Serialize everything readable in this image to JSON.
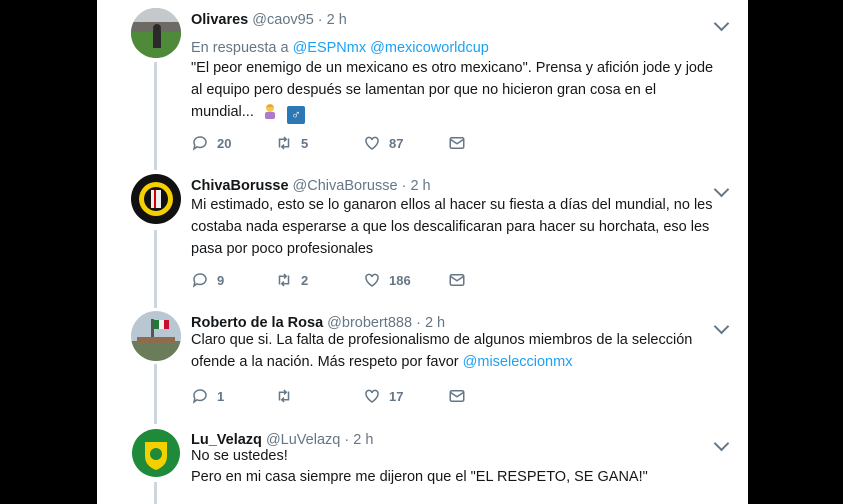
{
  "tweets": [
    {
      "name": "Olivares",
      "handle": "@caov95",
      "time": "2 h",
      "reply_prefix": "En respuesta a",
      "reply_mention1": "@ESPNmx",
      "reply_mention2": "@mexicoworldcup",
      "line1": "\"El peor enemigo de un mexicano es otro mexicano\". Prensa y afición jode y jode",
      "line2": "al equipo pero después se lamentan por que no hicieron gran cosa en el",
      "line3": "mundial...",
      "male_sign": "♂",
      "replies": "20",
      "retweets": "5",
      "likes": "87"
    },
    {
      "name": "ChivaBorusse",
      "handle": "@ChivaBorusse",
      "time": "2 h",
      "line1": "Mi estimado, esto se lo ganaron ellos al hacer su fiesta a días del mundial, no les",
      "line2": "costaba nada esperarse a que los descalificaran para hacer su horchata, eso les",
      "line3": "pasa por poco profesionales",
      "replies": "9",
      "retweets": "2",
      "likes": "186"
    },
    {
      "name": "Roberto de la Rosa",
      "handle": "@brobert888",
      "time": "2 h",
      "line1": "Claro que si. La falta de profesionalismo de algunos miembros de la selección",
      "line2_prefix": "ofende a  la nación. Más respeto por favor",
      "line2_mention": "@miseleccionmx",
      "replies": "1",
      "retweets": "",
      "likes": "17"
    },
    {
      "name": "Lu_Velazq",
      "handle": "@LuVelazq",
      "time": "2 h",
      "line1": "No se ustedes!",
      "line2": "Pero en mi casa siempre me dijeron que el \"EL RESPETO, SE GANA!\""
    }
  ],
  "separator": "·",
  "icons": [
    "reply-icon",
    "retweet-icon",
    "like-icon",
    "direct-message-icon",
    "chevron-down-icon"
  ],
  "colors": {
    "link": "#1da1f2",
    "muted": "#657786",
    "thread_line": "#cbd6de"
  }
}
